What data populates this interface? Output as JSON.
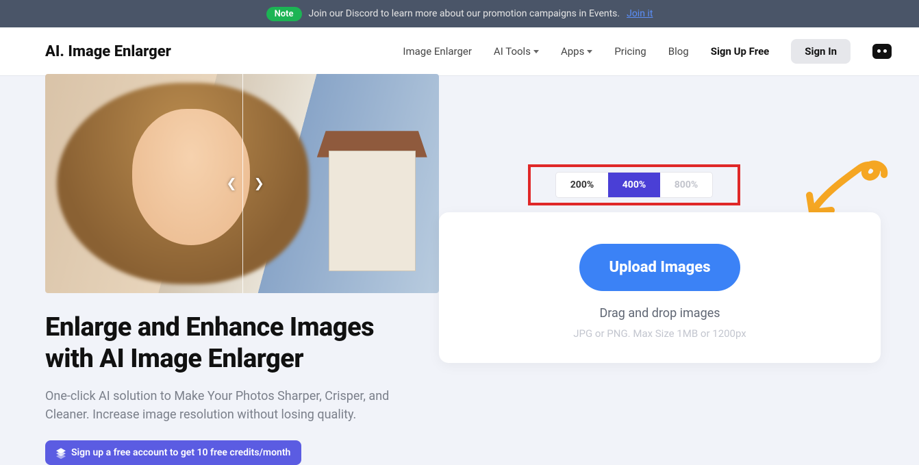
{
  "topbar": {
    "badge": "Note",
    "text": "Join our Discord to learn more about our promotion campaigns in Events.",
    "link": "Join it"
  },
  "header": {
    "logo": "AI. Image Enlarger",
    "nav": {
      "enlarger": "Image Enlarger",
      "tools": "AI Tools",
      "apps": "Apps",
      "pricing": "Pricing",
      "blog": "Blog",
      "signup": "Sign Up Free",
      "signin": "Sign In"
    }
  },
  "hero": {
    "title_l1": "Enlarge and Enhance Images",
    "title_l2": "with AI Image Enlarger",
    "subtitle": "One-click AI solution to Make Your Photos Sharper, Crisper, and Cleaner. Increase image resolution without losing quality.",
    "cta": "Sign up a free account to get 10 free credits/month"
  },
  "scale": {
    "opt1": "200%",
    "opt2": "400%",
    "opt3": "800%"
  },
  "upload": {
    "button": "Upload Images",
    "drag": "Drag and drop images",
    "hint": "JPG or PNG. Max Size 1MB or 1200px"
  }
}
